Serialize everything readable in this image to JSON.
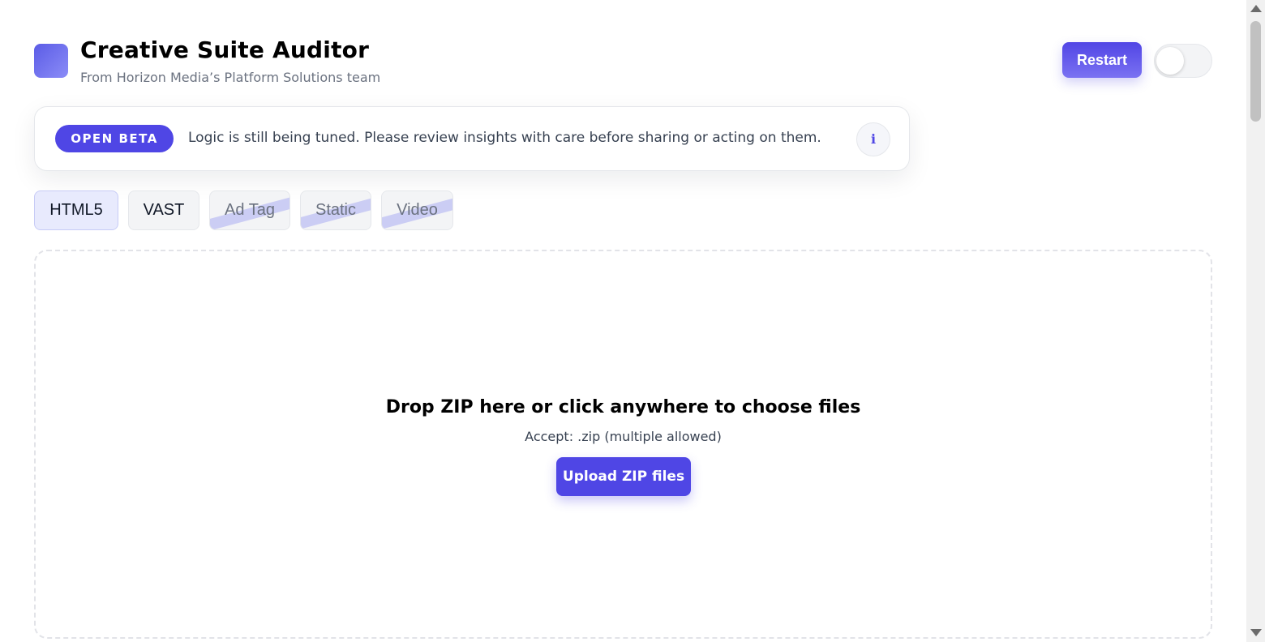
{
  "header": {
    "title": "Creative Suite Auditor",
    "subtitle": "From Horizon Media’s Platform Solutions team",
    "restart_label": "Restart",
    "theme_toggle_on": false
  },
  "banner": {
    "badge": "OPEN BETA",
    "message": "Logic is still being tuned. Please review insights with care before sharing or acting on them.",
    "info_icon": "i"
  },
  "tabs": [
    {
      "label": "HTML5",
      "state": "active"
    },
    {
      "label": "VAST",
      "state": "enabled"
    },
    {
      "label": "Ad Tag",
      "state": "disabled"
    },
    {
      "label": "Static",
      "state": "disabled"
    },
    {
      "label": "Video",
      "state": "disabled"
    }
  ],
  "dropzone": {
    "title": "Drop ZIP here or click anywhere to choose files",
    "accept": "Accept: .zip (multiple allowed)",
    "upload_label": "Upload ZIP files"
  },
  "colors": {
    "accent": "#4f46e5",
    "tab_active_bg": "#e8eafd",
    "strike": "#8184f1"
  }
}
